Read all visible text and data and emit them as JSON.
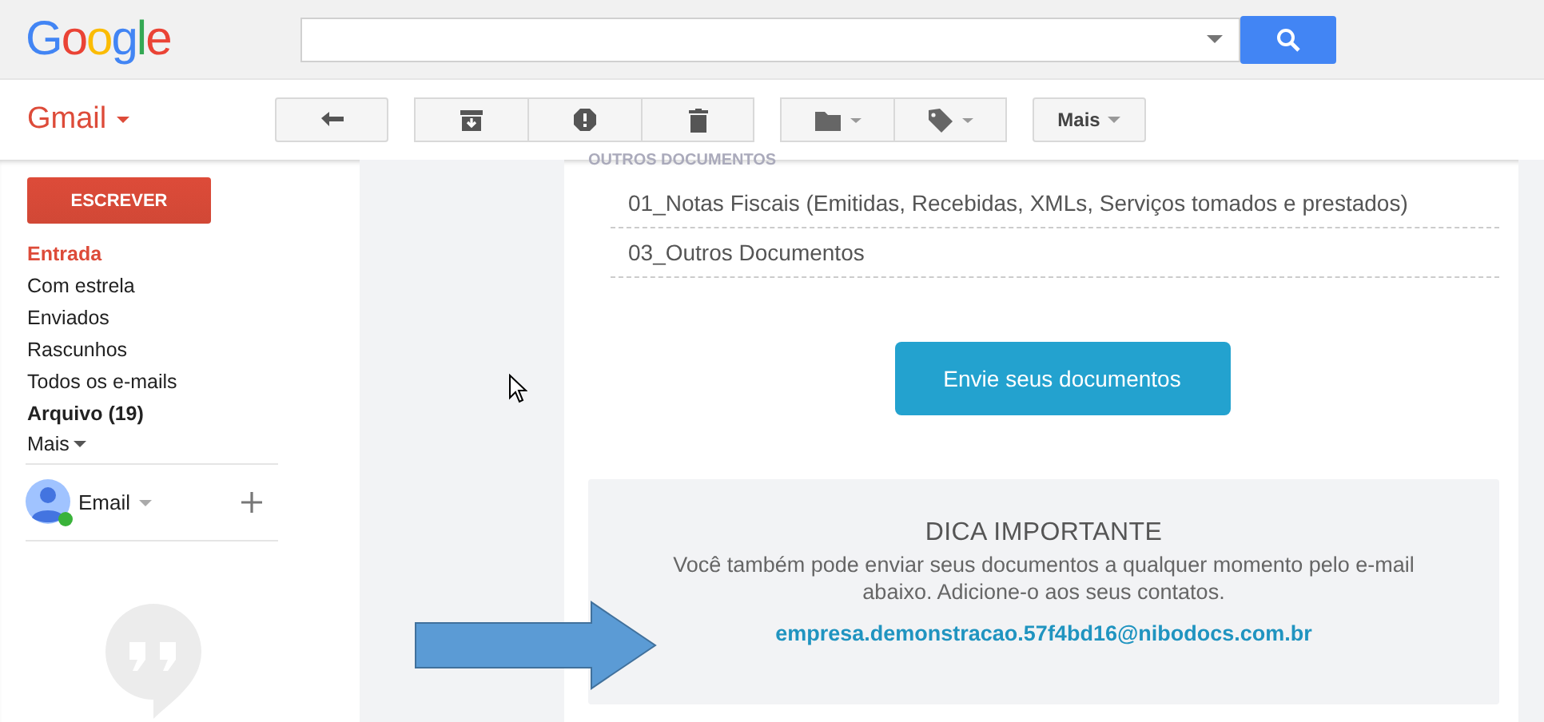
{
  "header": {
    "logo": "Google"
  },
  "toolbar": {
    "app_title": "Gmail",
    "more_button": "Mais"
  },
  "sidebar": {
    "compose_button": "ESCREVER",
    "items": [
      {
        "label": "Entrada",
        "selected": true,
        "unread": false
      },
      {
        "label": "Com estrela",
        "selected": false,
        "unread": false
      },
      {
        "label": "Enviados",
        "selected": false,
        "unread": false
      },
      {
        "label": "Rascunhos",
        "selected": false,
        "unread": false
      },
      {
        "label": "Todos os e-mails",
        "selected": false,
        "unread": false
      },
      {
        "label": "Arquivo (19)",
        "selected": false,
        "unread": true
      }
    ],
    "more_link": "Mais",
    "account": {
      "name": "Email",
      "online": true
    }
  },
  "email": {
    "section_heading": "OUTROS DOCUMENTOS",
    "documents": [
      "01_Notas Fiscais (Emitidas, Recebidas, XMLs, Serviços tomados e prestados)",
      "03_Outros Documentos"
    ],
    "send_button": "Envie seus documentos",
    "tip": {
      "title": "DICA IMPORTANTE",
      "text": "Você também pode enviar seus documentos a qualquer momento pelo e-mail abaixo. Adicione-o aos seus contatos.",
      "address": "empresa.demonstracao.57f4bd16@nibodocs.com.br"
    }
  }
}
